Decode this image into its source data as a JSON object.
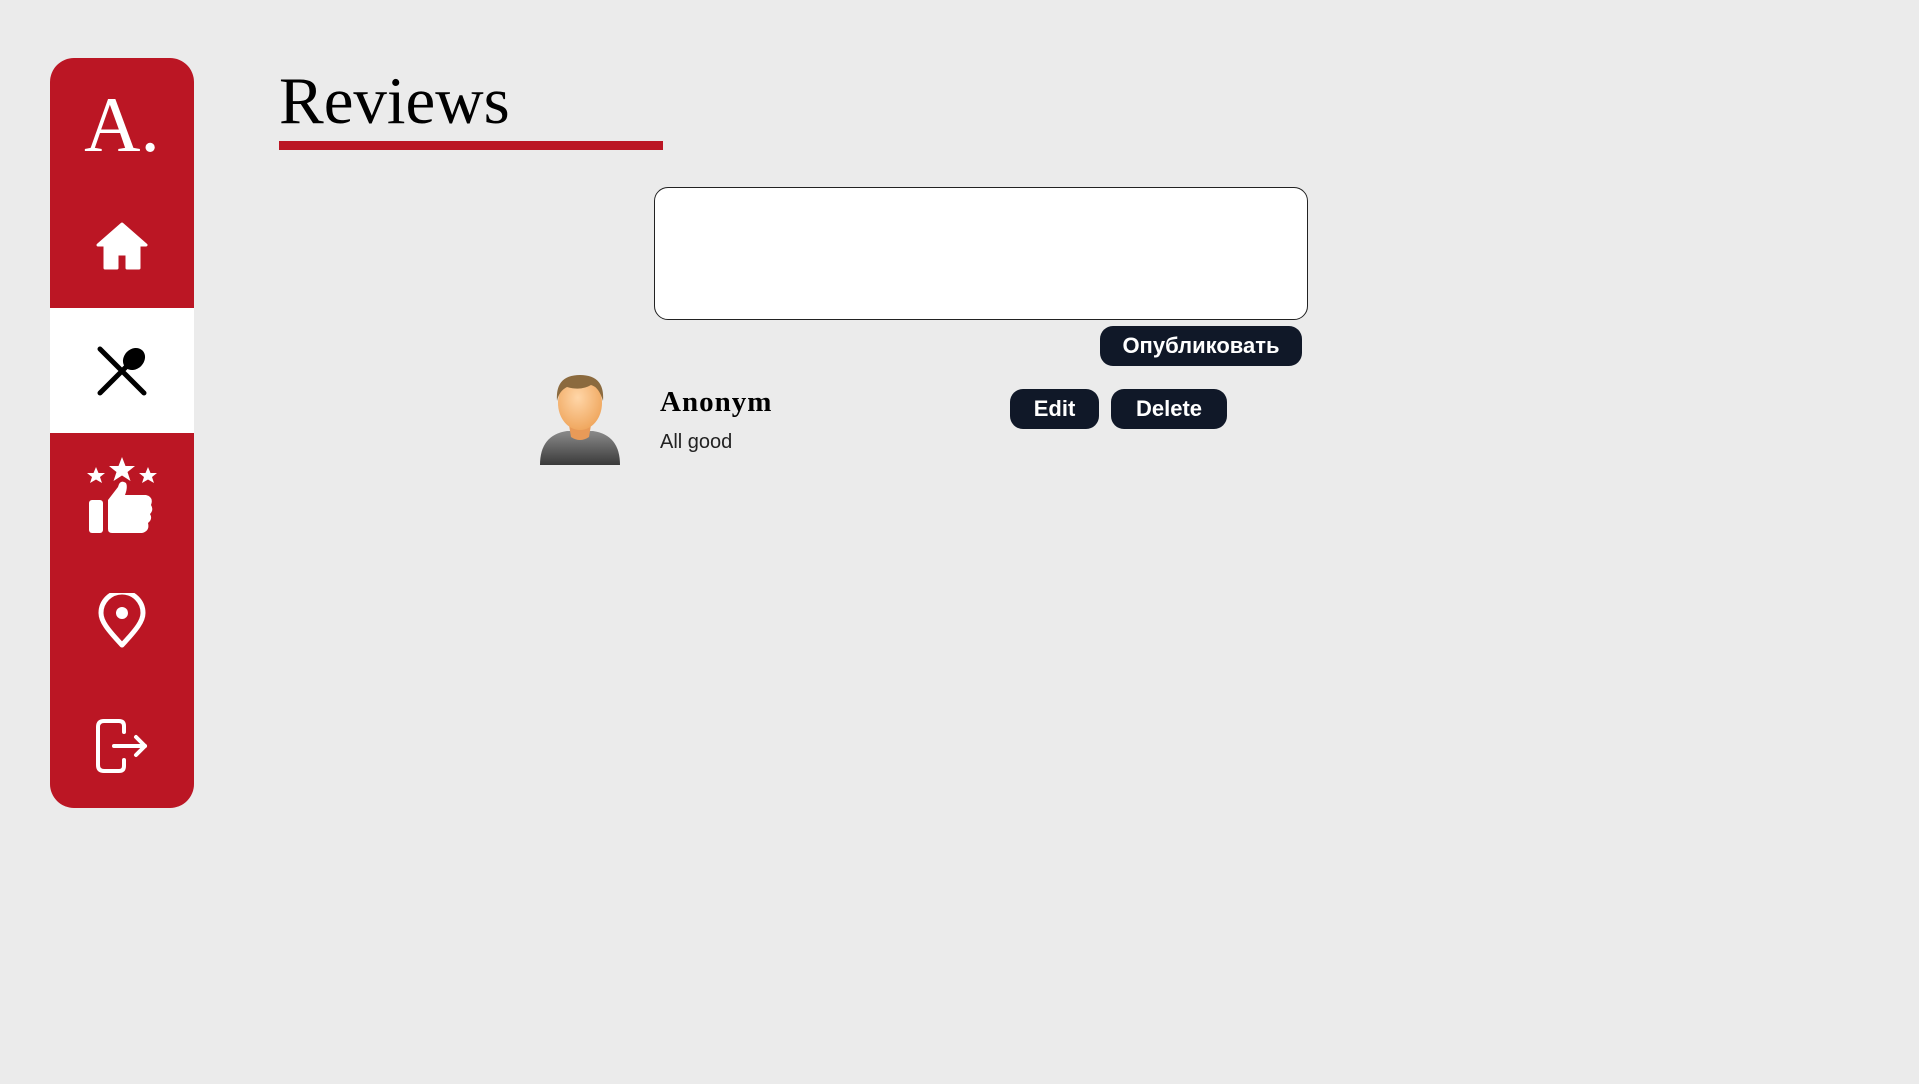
{
  "sidebar": {
    "logo": "A.",
    "items": [
      {
        "icon": "home-icon",
        "active": false
      },
      {
        "icon": "utensils-icon",
        "active": true
      },
      {
        "icon": "rating-icon",
        "active": false
      },
      {
        "icon": "location-pin-icon",
        "active": false
      },
      {
        "icon": "logout-icon",
        "active": false
      }
    ],
    "accent_color": "#bb1624"
  },
  "page": {
    "title": "Reviews"
  },
  "review_form": {
    "value": "",
    "placeholder": "",
    "publish_label": "Опубликовать"
  },
  "reviews": [
    {
      "author": "Anonym",
      "text": "All good",
      "avatar_icon": "user-avatar-icon",
      "edit_label": "Edit",
      "delete_label": "Delete"
    }
  ],
  "colors": {
    "background": "#ebebeb",
    "button": "#101828",
    "accent": "#bb1624"
  }
}
